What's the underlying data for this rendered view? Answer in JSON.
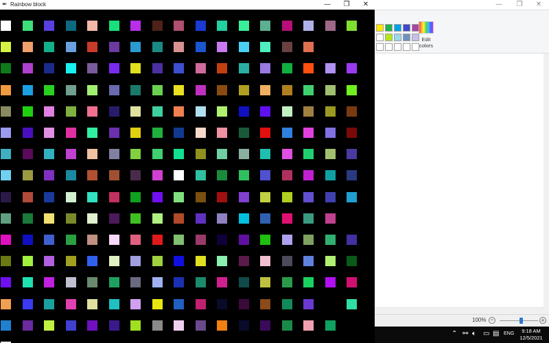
{
  "tk_window": {
    "title": "Rainbow block",
    "grid_columns": 17,
    "grid_rows": 16,
    "cells": [
      "#ffffff",
      "#3ee07a",
      "#5a3fe0",
      "#0c6a80",
      "#f5b8a8",
      "#18e07a",
      "#b72fe8",
      "#4e2218",
      "#b04f70",
      "#1a3ad0",
      "#22d0a0",
      "#3aef9a",
      "#5ab090",
      "#b80e78",
      "#b0b0e8",
      "#a06888",
      "#80e030",
      "#d6f242",
      "#f0a06a",
      "#12b08a",
      "#6aa0e0",
      "#c83a2a",
      "#6a3aa0",
      "#2a9ad0",
      "#1a8a86",
      "#d89090",
      "#1a56d0",
      "#c87af0",
      "#4ad0f0",
      "#4ef0c0",
      "#6a4040",
      "#e07050",
      "#000000",
      "#000000",
      "#0e7a1a",
      "#b040d0",
      "#1a2a8a",
      "#18f0f0",
      "#7a5a9a",
      "#7a2af0",
      "#e0e020",
      "#4a30a0",
      "#3a50d0",
      "#d06a9a",
      "#c04010",
      "#2ab0a0",
      "#9a7ae0",
      "#10b040",
      "#ff5010",
      "#b090f0",
      "#9a3af0",
      "#f09a40",
      "#1aa0e0",
      "#2ad020",
      "#70a090",
      "#a0f070",
      "#6a6ab0",
      "#1a7a6a",
      "#6ad050",
      "#e8e020",
      "#c030c0",
      "#8a4a10",
      "#b0a020",
      "#f0b060",
      "#b08020",
      "#40d070",
      "#a0c070",
      "#70f020",
      "#8a8a60",
      "#20d010",
      "#e080e0",
      "#80b040",
      "#f07090",
      "#2a1a6a",
      "#e0e0a0",
      "#40d0a0",
      "#f08050",
      "#b0e0f0",
      "#b0f070",
      "#1010c0",
      "#6010f0",
      "#c0f0c0",
      "#a08040",
      "#9a9a20",
      "#7a3a10",
      "#9a9af0",
      "#4a10c0",
      "#e090e0",
      "#e030a0",
      "#30f0a0",
      "#6a30b0",
      "#e0d010",
      "#20b040",
      "#103a90",
      "#f8d8c8",
      "#f090a0",
      "#1a5a3a",
      "#e01010",
      "#3080e0",
      "#e040e0",
      "#8070e0",
      "#7a0a0a",
      "#40b0c0",
      "#5a0a5a",
      "#30b0c0",
      "#c040d0",
      "#f0c0a0",
      "#8080a0",
      "#80d040",
      "#40d070",
      "#10e090",
      "#909020",
      "#70d0a0",
      "#8ab0a0",
      "#20c0b0",
      "#e050e0",
      "#20d070",
      "#a0c070",
      "#4a3aa0",
      "#70d0f0",
      "#9a9a40",
      "#8030c0",
      "#1a8aa0",
      "#b05030",
      "#a05030",
      "#4a2a4a",
      "#d040d0",
      "#ffffff",
      "#30c0a0",
      "#1a8a3a",
      "#30c060",
      "#5050d0",
      "#b03060",
      "#c020d0",
      "#10a0a0",
      "#2a3a80",
      "#2a1a4a",
      "#b04a3a",
      "#1a3a9a",
      "#d0f0d0",
      "#30e0c0",
      "#c03060",
      "#10a020",
      "#7010f0",
      "#80e080",
      "#7a5010",
      "#a01010",
      "#8040d0",
      "#c0d040",
      "#b0d020",
      "#6050d0",
      "#4040b0",
      "#20a0d0",
      "#60a080",
      "#1a7a3a",
      "#f0e070",
      "#7a8a2a",
      "#e0f0d0",
      "#4a1a5a",
      "#40c020",
      "#b0f080",
      "#b04a2a",
      "#6030c0",
      "#9080c0",
      "#00c0e0",
      "#3060b0",
      "#e01070",
      "#3a9a80",
      "#c04090",
      "#000000",
      "#e010c0",
      "#1010c0",
      "#4060d0",
      "#2aa040",
      "#c09080",
      "#f8d8f8",
      "#e06080",
      "#e01a1a",
      "#80c070",
      "#9a3a6a",
      "#10003a",
      "#6010a0",
      "#20c010",
      "#b0a0f0",
      "#80a060",
      "#30b070",
      "#4030a0",
      "#6a7a10",
      "#a0f040",
      "#b060e0",
      "#a0a020",
      "#3060f0",
      "#e0f0c0",
      "#a0a0e0",
      "#a0d040",
      "#1010e0",
      "#e0e020",
      "#8af0b0",
      "#5a1a4a",
      "#f0c0d0",
      "#4a4a5a",
      "#6080e0",
      "#b0f070",
      "#0a5a1a",
      "#7010f0",
      "#20e0b0",
      "#c020e0",
      "#c0c0d0",
      "#6a8a70",
      "#20a060",
      "#6a6a80",
      "#a0b0f0",
      "#1a30b0",
      "#1a8a6a",
      "#d02090",
      "#104a4a",
      "#c0c040",
      "#2a9a4a",
      "#1ad060",
      "#b010f0",
      "#d01070",
      "#f0a050",
      "#3a3af0",
      "#1aa0a0",
      "#e040b0",
      "#e0e0a0",
      "#20c0c0",
      "#d0a0f0",
      "#e8e810",
      "#2060c0",
      "#c02070",
      "#0a0a2a",
      "#3a0a3a",
      "#8a4a1a",
      "#108a5a",
      "#6a3ad0",
      "#000000",
      "#30e0a0",
      "#2080d0",
      "#6a2aa0",
      "#c0f040",
      "#4040d0",
      "#7010c0",
      "#3a1a8a",
      "#a0e020",
      "#8a8a8a",
      "#f0d0f0",
      "#6a4a8a",
      "#f08010",
      "#0a0a2a",
      "#3a0a5a",
      "#1a8a4a",
      "#f0a0b0",
      "#10a060",
      "#000000",
      "#ffffff",
      "#000000",
      "#000000",
      "#000000",
      "#000000",
      "#000000",
      "#000000",
      "#000000",
      "#000000",
      "#000000",
      "#000000",
      "#000000",
      "#000000",
      "#000000",
      "#000000",
      "#000000",
      "#000000"
    ]
  },
  "paint_window": {
    "palette_colors": [
      "#ffe600",
      "#22b14c",
      "#00a2e8",
      "#3f48cc",
      "#a349a4",
      "#ffffff",
      "#b5e61d",
      "#99d9ea",
      "#7092be",
      "#c8bfe7",
      "#ffffff",
      "#ffffff",
      "#ffffff",
      "#ffffff",
      "#ffffff",
      "#ffffff"
    ],
    "edit_colors_label": "Edit colors",
    "zoom_label": "100%",
    "zoom_level_percent": 100
  },
  "taskbar": {
    "language": "ENG",
    "time": "9:18 AM",
    "date": "12/5/2021"
  },
  "icons": {
    "feather": "feather-icon",
    "minimize": "minimize-icon",
    "restore": "restore-icon",
    "close": "close-icon",
    "chevron_up": "chevron-up-icon",
    "network": "network-icon",
    "volume": "volume-icon",
    "battery": "battery-icon",
    "notification": "notification-icon"
  }
}
